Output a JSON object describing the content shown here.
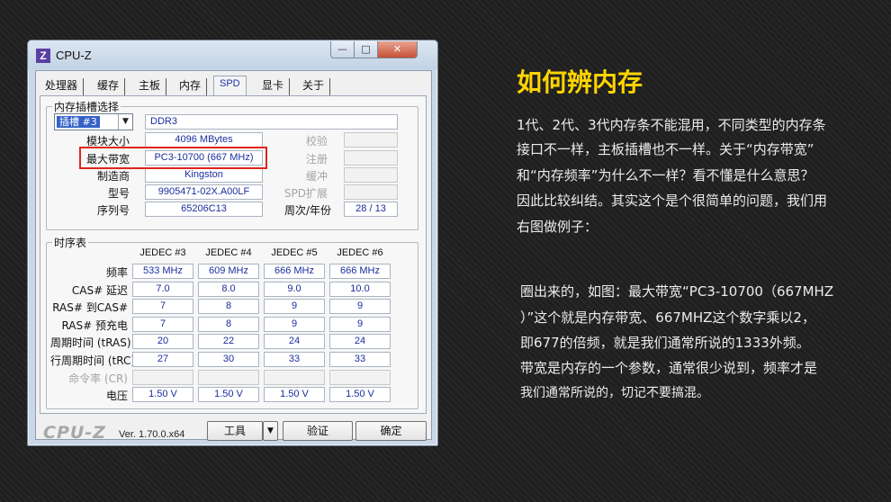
{
  "window": {
    "icon_letter": "Z",
    "title": "CPU-Z",
    "caption": {
      "min": "—",
      "max": "□",
      "close": "✕"
    }
  },
  "tabs": [
    "处理器",
    "缓存",
    "主板",
    "内存",
    "SPD",
    "显卡",
    "关于"
  ],
  "active_tab": "SPD",
  "slot": {
    "legend": "内存插槽选择",
    "selected": "插槽 #3",
    "type": "DDR3",
    "rows": [
      {
        "label": "模块大小",
        "value": "4096 MBytes",
        "right_label": "校验",
        "right_value": ""
      },
      {
        "label": "最大带宽",
        "value": "PC3-10700 (667 MHz)",
        "right_label": "注册",
        "right_value": ""
      },
      {
        "label": "制造商",
        "value": "Kingston",
        "right_label": "缓冲",
        "right_value": ""
      },
      {
        "label": "型号",
        "value": "9905471-02X.A00LF",
        "right_label": "SPD扩展",
        "right_value": ""
      },
      {
        "label": "序列号",
        "value": "65206C13",
        "right_label": "周次/年份",
        "right_value": "28 / 13"
      }
    ]
  },
  "timing": {
    "legend": "时序表",
    "columns": [
      "JEDEC #3",
      "JEDEC #4",
      "JEDEC #5",
      "JEDEC #6"
    ],
    "rows": [
      {
        "label": "频率",
        "values": [
          "533 MHz",
          "609 MHz",
          "666 MHz",
          "666 MHz"
        ],
        "dim": false
      },
      {
        "label": "CAS# 延迟",
        "values": [
          "7.0",
          "8.0",
          "9.0",
          "10.0"
        ],
        "dim": false
      },
      {
        "label": "RAS# 到CAS#",
        "values": [
          "7",
          "8",
          "9",
          "9"
        ],
        "dim": false
      },
      {
        "label": "RAS# 预充电",
        "values": [
          "7",
          "8",
          "9",
          "9"
        ],
        "dim": false
      },
      {
        "label": "周期时间 (tRAS)",
        "values": [
          "20",
          "22",
          "24",
          "24"
        ],
        "dim": false
      },
      {
        "label": "行周期时间 (tRC)",
        "values": [
          "27",
          "30",
          "33",
          "33"
        ],
        "dim": false
      },
      {
        "label": "命令率 (CR)",
        "values": [
          "",
          "",
          "",
          ""
        ],
        "dim": true
      },
      {
        "label": "电压",
        "values": [
          "1.50 V",
          "1.50 V",
          "1.50 V",
          "1.50 V"
        ],
        "dim": false
      }
    ]
  },
  "footer": {
    "logo": "CPU-Z",
    "version": "Ver. 1.70.0.x64",
    "tools_label": "工具",
    "validate_label": "验证",
    "ok_label": "确定"
  },
  "article": {
    "heading": "如何辨内存",
    "para1": [
      "1代、2代、3代内存条不能混用，不同类型的内存条",
      "接口不一样，主板插槽也不一样。关于“内存带宽”",
      "和“内存频率”为什么不一样？看不懂是什么意思？",
      "因此比较纠结。其实这个是个很简单的问题，我们用",
      "右图做例子："
    ],
    "para2": [
      "圈出来的，如图：最大带宽“PC3-10700（667MHZ",
      "）”这个就是内存带宽、667MHZ这个数字乘以2，",
      "即677的倍频，就是我们通常所说的1333外频。",
      "带宽是内存的一个参数，通常很少说到，频率才是",
      "我们通常所说的，切记不要搞混。"
    ]
  }
}
